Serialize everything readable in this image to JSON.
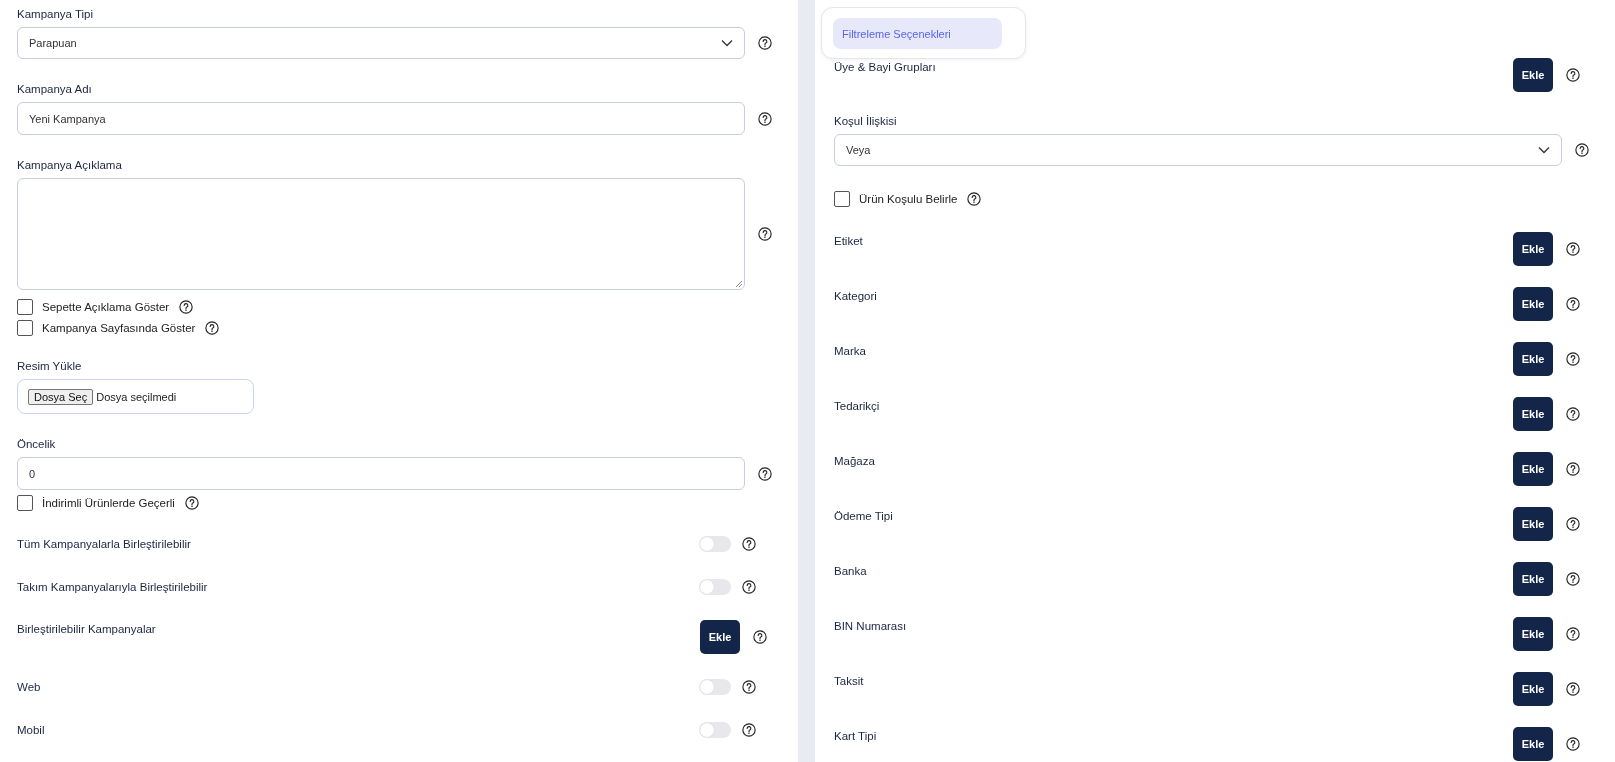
{
  "left": [
    {
      "kind": "select",
      "label": "Kampanya Tipi",
      "value": "Parapuan"
    },
    {
      "kind": "input",
      "label": "Kampanya Adı",
      "value": "Yeni Kampanya"
    },
    {
      "kind": "textarea",
      "label": "Kampanya Açıklama"
    },
    {
      "kind": "checkbox",
      "label": "Sepette Açıklama Göster",
      "checked": false
    },
    {
      "kind": "checkbox",
      "label": "Kampanya Sayfasında Göster",
      "checked": false
    },
    {
      "kind": "file",
      "label": "Resim Yükle",
      "button": "Dosya Seç",
      "status": "Dosya seçilmedi"
    },
    {
      "kind": "input",
      "label": "Öncelik",
      "value": "0"
    },
    {
      "kind": "checkbox",
      "label": "İndirimli Ürünlerde Geçerli",
      "checked": false
    },
    {
      "kind": "toggle",
      "label": "Tüm Kampanyalarla Birleştirilebilir",
      "on": false
    },
    {
      "kind": "toggle",
      "label": "Takım Kampanyalarıyla Birleştirilebilir",
      "on": false
    },
    {
      "kind": "add",
      "label": "Birleştirilebilir Kampanyalar",
      "button": "Ekle"
    },
    {
      "kind": "toggle",
      "label": "Web",
      "on": false
    },
    {
      "kind": "toggle",
      "label": "Mobil",
      "on": false
    }
  ],
  "right": {
    "tabs": [
      {
        "label": "Filtreleme Seçenekleri",
        "selected": true
      }
    ],
    "items": [
      {
        "kind": "add",
        "label": "Üye & Bayi Grupları",
        "button": "Ekle"
      },
      {
        "kind": "select",
        "label": "Koşul İlişkisi",
        "value": "Veya"
      },
      {
        "kind": "checkbox",
        "label": "Ürün Koşulu Belirle",
        "checked": false
      },
      {
        "kind": "add",
        "label": "Etiket",
        "button": "Ekle"
      },
      {
        "kind": "add",
        "label": "Kategori",
        "button": "Ekle"
      },
      {
        "kind": "add",
        "label": "Marka",
        "button": "Ekle"
      },
      {
        "kind": "add",
        "label": "Tedarikçi",
        "button": "Ekle"
      },
      {
        "kind": "add",
        "label": "Mağaza",
        "button": "Ekle"
      },
      {
        "kind": "add",
        "label": "Ödeme Tipi",
        "button": "Ekle"
      },
      {
        "kind": "add",
        "label": "Banka",
        "button": "Ekle"
      },
      {
        "kind": "add",
        "label": "BIN Numarası",
        "button": "Ekle"
      },
      {
        "kind": "add",
        "label": "Taksit",
        "button": "Ekle"
      },
      {
        "kind": "add",
        "label": "Kart Tipi",
        "button": "Ekle"
      }
    ]
  }
}
